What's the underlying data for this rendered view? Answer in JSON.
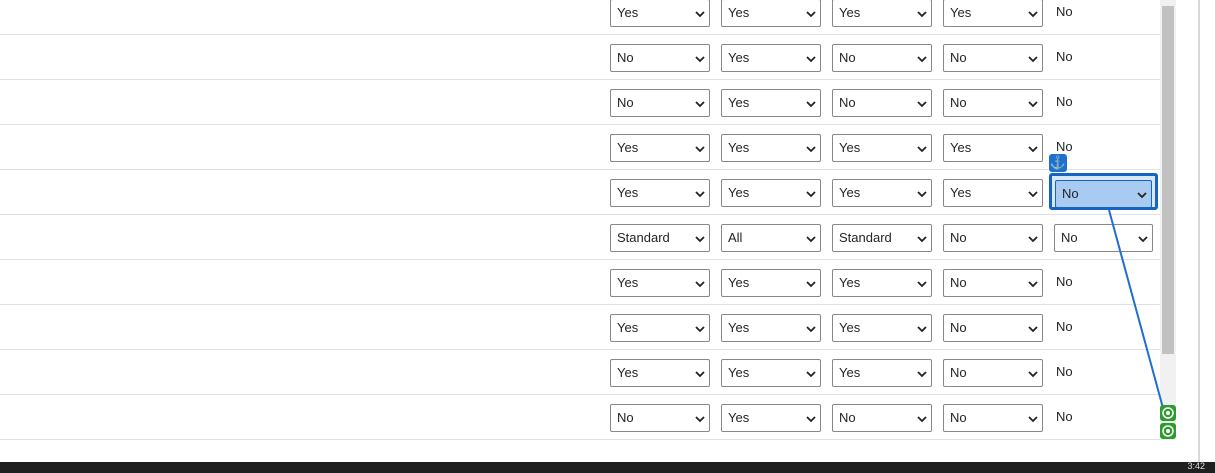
{
  "rows": [
    {
      "cells": [
        "Yes",
        "Yes",
        "Yes",
        "Yes"
      ],
      "last": "No",
      "last_is_select": false
    },
    {
      "cells": [
        "No",
        "Yes",
        "No",
        "No"
      ],
      "last": "No",
      "last_is_select": false
    },
    {
      "cells": [
        "No",
        "Yes",
        "No",
        "No"
      ],
      "last": "No",
      "last_is_select": false
    },
    {
      "cells": [
        "Yes",
        "Yes",
        "Yes",
        "Yes"
      ],
      "last": "No",
      "last_is_select": false
    },
    {
      "cells": [
        "Yes",
        "Yes",
        "Yes",
        "Yes"
      ],
      "last": "No",
      "last_is_select": true,
      "highlighted": true
    },
    {
      "cells": [
        "Standard",
        "All",
        "Standard",
        "No"
      ],
      "last": "No",
      "last_is_select": true
    },
    {
      "cells": [
        "Yes",
        "Yes",
        "Yes",
        "No"
      ],
      "last": "No",
      "last_is_select": false
    },
    {
      "cells": [
        "Yes",
        "Yes",
        "Yes",
        "No"
      ],
      "last": "No",
      "last_is_select": false
    },
    {
      "cells": [
        "Yes",
        "Yes",
        "Yes",
        "No"
      ],
      "last": "No",
      "last_is_select": false
    },
    {
      "cells": [
        "No",
        "Yes",
        "No",
        "No"
      ],
      "last": "No",
      "last_is_select": false
    }
  ],
  "overlay": {
    "highlight_color": "#1565c0",
    "anchor_icon": "anchor-icon",
    "target_icon": "target-icon",
    "target_color": "#2e9b2e"
  },
  "taskbar": {
    "time": "3:42"
  }
}
